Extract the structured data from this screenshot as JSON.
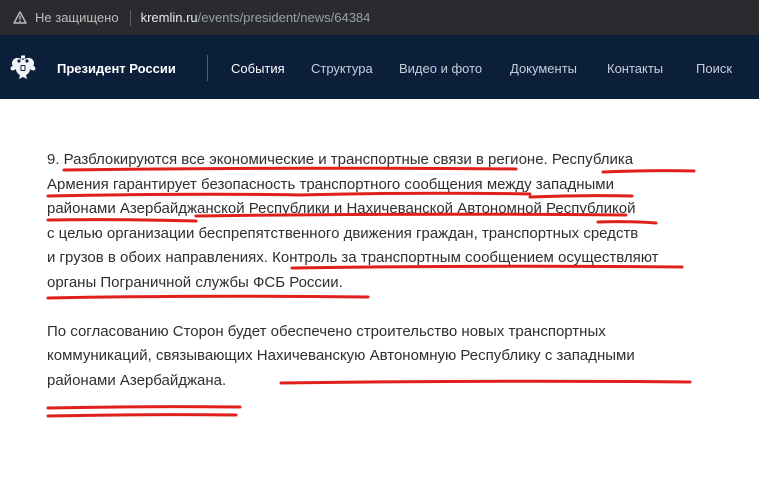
{
  "browser": {
    "security_label": "Не защищено",
    "url_host": "kremlin.ru",
    "url_path": "/events/president/news/64384"
  },
  "header": {
    "site_title": "Президент России",
    "nav": [
      {
        "label": "События",
        "active": true
      },
      {
        "label": "Структура",
        "active": false
      },
      {
        "label": "Видео и фото",
        "active": false
      },
      {
        "label": "Документы",
        "active": false
      },
      {
        "label": "Контакты",
        "active": false
      },
      {
        "label": "Поиск",
        "active": false
      }
    ]
  },
  "article": {
    "p1_lines": [
      "9. Разблокируются все экономические и транспортные связи в регионе. Республика",
      "Армения гарантирует безопасность транспортного сообщения между западными",
      "районами Азербайджанской Республики и Нахичеванской Автономной Республикой",
      "с целью организации беспрепятственного движения граждан, транспортных средств",
      "и грузов в обоих направлениях. Контроль за транспортным сообщением осуществляют",
      "органы Пограничной службы ФСБ России."
    ],
    "p2_lines": [
      "По согласованию Сторон будет обеспечено строительство новых транспортных",
      "коммуникаций, связывающих Нахичеванскую Автономную Республику с западными",
      "районами Азербайджана."
    ]
  },
  "colors": {
    "annotation": "#e0201c",
    "header_bg": "#0b1e3a",
    "addrbar_bg": "#2a2b2e"
  }
}
